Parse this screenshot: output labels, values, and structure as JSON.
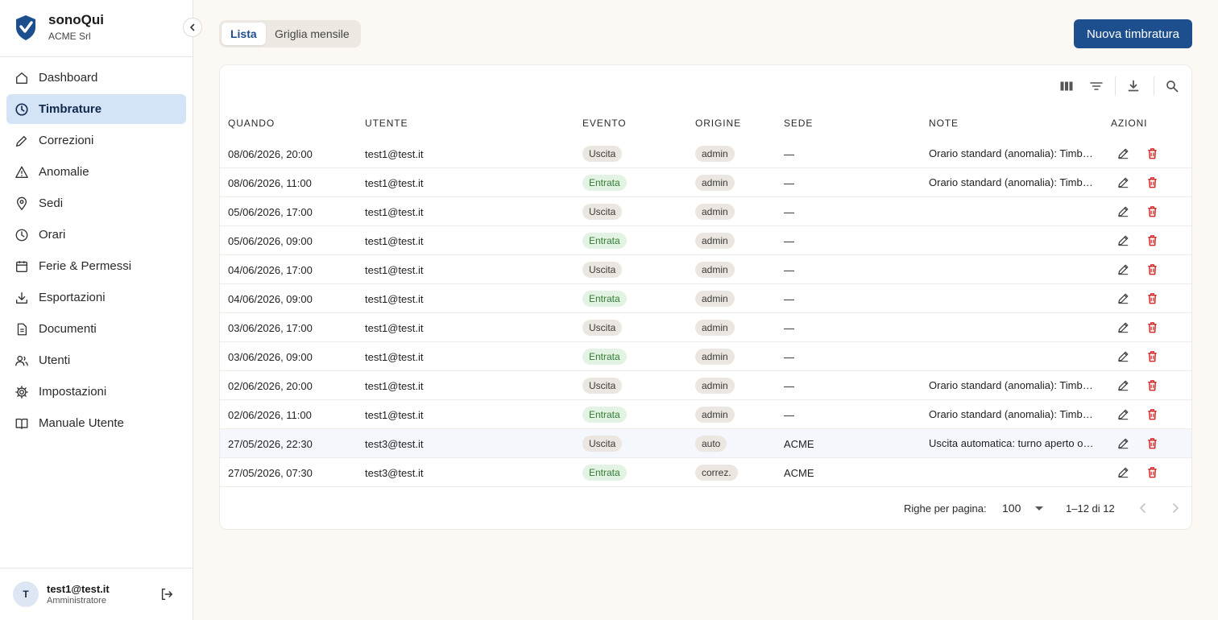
{
  "brand": {
    "name": "sonoQui",
    "org": "ACME Srl"
  },
  "nav": [
    {
      "label": "Dashboard",
      "icon": "home-icon",
      "active": false
    },
    {
      "label": "Timbrature",
      "icon": "clock-icon",
      "active": true
    },
    {
      "label": "Correzioni",
      "icon": "pencil-icon",
      "active": false
    },
    {
      "label": "Anomalie",
      "icon": "warning-icon",
      "active": false
    },
    {
      "label": "Sedi",
      "icon": "location-pin-icon",
      "active": false
    },
    {
      "label": "Orari",
      "icon": "clock-icon",
      "active": false
    },
    {
      "label": "Ferie & Permessi",
      "icon": "calendar-icon",
      "active": false
    },
    {
      "label": "Esportazioni",
      "icon": "download-icon",
      "active": false
    },
    {
      "label": "Documenti",
      "icon": "document-icon",
      "active": false
    },
    {
      "label": "Utenti",
      "icon": "users-icon",
      "active": false
    },
    {
      "label": "Impostazioni",
      "icon": "gear-icon",
      "active": false
    },
    {
      "label": "Manuale Utente",
      "icon": "book-icon",
      "active": false
    }
  ],
  "user": {
    "initial": "T",
    "email": "test1@test.it",
    "role": "Amministratore"
  },
  "view_toggle": {
    "list": "Lista",
    "grid": "Griglia mensile",
    "selected": "Lista"
  },
  "new_button": "Nuova timbratura",
  "table": {
    "columns": [
      "QUANDO",
      "UTENTE",
      "EVENTO",
      "ORIGINE",
      "SEDE",
      "NOTE",
      "AZIONI"
    ],
    "rows": [
      {
        "when": "08/06/2026, 20:00",
        "user": "test1@test.it",
        "event": "Uscita",
        "origin": "admin",
        "site": "—",
        "note": "Orario standard (anomalia): Timbratura"
      },
      {
        "when": "08/06/2026, 11:00",
        "user": "test1@test.it",
        "event": "Entrata",
        "origin": "admin",
        "site": "—",
        "note": "Orario standard (anomalia): Timbratura"
      },
      {
        "when": "05/06/2026, 17:00",
        "user": "test1@test.it",
        "event": "Uscita",
        "origin": "admin",
        "site": "—",
        "note": ""
      },
      {
        "when": "05/06/2026, 09:00",
        "user": "test1@test.it",
        "event": "Entrata",
        "origin": "admin",
        "site": "—",
        "note": ""
      },
      {
        "when": "04/06/2026, 17:00",
        "user": "test1@test.it",
        "event": "Uscita",
        "origin": "admin",
        "site": "—",
        "note": ""
      },
      {
        "when": "04/06/2026, 09:00",
        "user": "test1@test.it",
        "event": "Entrata",
        "origin": "admin",
        "site": "—",
        "note": ""
      },
      {
        "when": "03/06/2026, 17:00",
        "user": "test1@test.it",
        "event": "Uscita",
        "origin": "admin",
        "site": "—",
        "note": ""
      },
      {
        "when": "03/06/2026, 09:00",
        "user": "test1@test.it",
        "event": "Entrata",
        "origin": "admin",
        "site": "—",
        "note": ""
      },
      {
        "when": "02/06/2026, 20:00",
        "user": "test1@test.it",
        "event": "Uscita",
        "origin": "admin",
        "site": "—",
        "note": "Orario standard (anomalia): Timbratura"
      },
      {
        "when": "02/06/2026, 11:00",
        "user": "test1@test.it",
        "event": "Entrata",
        "origin": "admin",
        "site": "—",
        "note": "Orario standard (anomalia): Timbratura"
      },
      {
        "when": "27/05/2026, 22:30",
        "user": "test3@test.it",
        "event": "Uscita",
        "origin": "auto",
        "site": "ACME",
        "note": "Uscita automatica: turno aperto oltre"
      },
      {
        "when": "27/05/2026, 07:30",
        "user": "test3@test.it",
        "event": "Entrata",
        "origin": "correz.",
        "site": "ACME",
        "note": ""
      }
    ]
  },
  "pagination": {
    "label": "Righe per pagina:",
    "per_page": "100",
    "range": "1–12 di 12"
  },
  "colors": {
    "accent": "#1d4f8f",
    "active_nav": "#d5e3f7",
    "delete": "#d32f2f",
    "entry_chip": "#e2f2e3"
  }
}
